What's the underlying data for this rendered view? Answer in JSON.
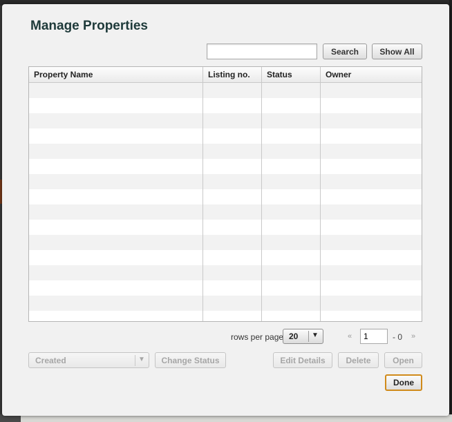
{
  "dialog": {
    "title": "Manage Properties"
  },
  "search": {
    "value": "",
    "placeholder": "",
    "search_label": "Search",
    "show_all_label": "Show All"
  },
  "table": {
    "columns": [
      "Property Name",
      "Listing no.",
      "Status",
      "Owner"
    ],
    "rows": []
  },
  "pagination": {
    "rows_per_page_label": "rows per page",
    "rows_per_page_value": "20",
    "prev_symbol": "«",
    "page_value": "1",
    "total_text": "- 0",
    "next_symbol": "»"
  },
  "actions": {
    "status_select_value": "Created",
    "change_status_label": "Change Status",
    "edit_details_label": "Edit Details",
    "delete_label": "Delete",
    "open_label": "Open",
    "done_label": "Done"
  },
  "icons": {
    "dropdown_arrow": "▼"
  },
  "colors": {
    "title": "#1e3a3a",
    "done_border": "#d08a1a",
    "row_alt": "#f2f2f2"
  }
}
